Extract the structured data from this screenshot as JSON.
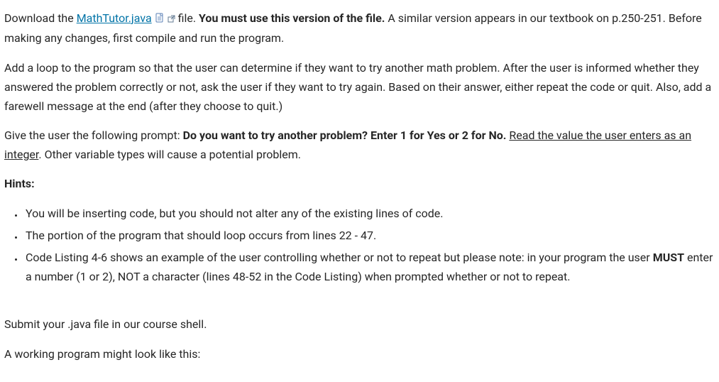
{
  "para1": {
    "t1": "Download the ",
    "link": "MathTutor.java",
    "t2": " file.  ",
    "bold": "You must use this version of the file.",
    "t3": " A similar version appears in our textbook on p.250-251.  Before making any changes, first compile and run the program."
  },
  "para2": "Add a loop to the program so that the user can determine if they want to try another math problem.  After the user is informed whether they answered the problem correctly or not, ask the user if they want to try again.  Based on their answer, either repeat the code or quit.  Also, add a farewell message at the end (after they choose to quit.)",
  "para3": {
    "t1": "Give the user the following prompt:  ",
    "bold": "Do you want to try another problem?  Enter 1 for Yes or 2 for No.",
    "t2": "  ",
    "ul": "Read the value the user enters as an integer",
    "t3": ". Other variable types will cause a potential problem."
  },
  "hintsHeading": "Hints:",
  "hints": {
    "h1": "You will be inserting code, but you should not alter any of the existing lines of code.",
    "h2": "The portion of the program that should loop occurs from lines 22 - 47.",
    "h3": {
      "t1": "Code Listing 4-6 shows an example of the user controlling whether or not to repeat but please note: in your program the user ",
      "bold": "MUST",
      "t2": " enter a number (1 or 2), NOT a character (lines 48-52 in the Code Listing) when prompted whether or not to repeat."
    }
  },
  "para4": "Submit your .java file in our course shell.",
  "para5": "A working program might look like this:"
}
